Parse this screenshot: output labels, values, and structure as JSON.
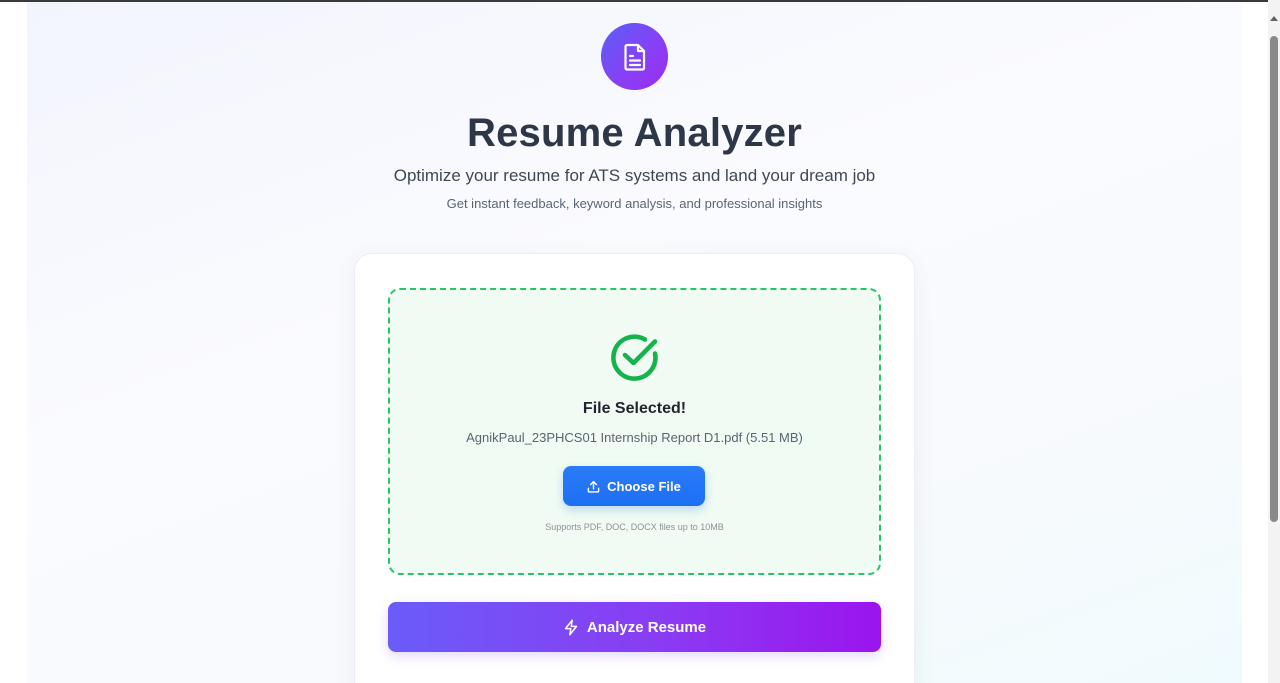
{
  "header": {
    "logo_icon": "document-icon",
    "title": "Resume Analyzer",
    "subtitle": "Optimize your resume for ATS systems and land your dream job",
    "tagline": "Get instant feedback, keyword analysis, and professional insights"
  },
  "upload": {
    "status_icon": "check-circle-icon",
    "status_title": "File Selected!",
    "file_name": "AgnikPaul_23PHCS01 Internship Report D1.pdf (5.51 MB)",
    "choose_button_label": "Choose File",
    "choose_button_icon": "upload-icon",
    "supported_formats": "Supports PDF, DOC, DOCX files up to 10MB"
  },
  "actions": {
    "analyze_button_label": "Analyze Resume",
    "analyze_button_icon": "lightning-icon"
  },
  "colors": {
    "success_green": "#22c55e",
    "primary_blue": "#1d6ff3",
    "accent_purple": "#8a3cf3",
    "heading_dark": "#2d3748"
  }
}
